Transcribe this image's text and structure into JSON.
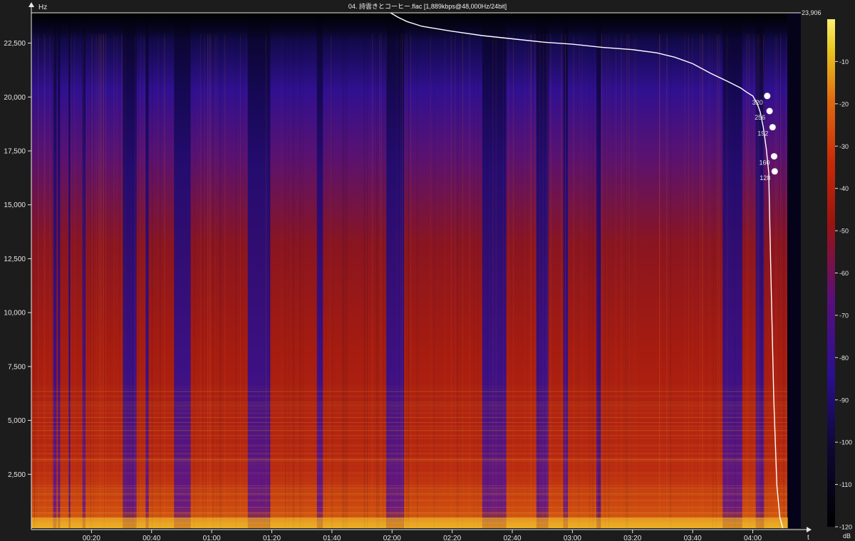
{
  "window": {
    "title": "04. 詩雲きとコーヒー.flac [1,889kbps@48,000Hz/24bit]"
  },
  "chart_data": {
    "type": "heatmap",
    "title": "04. 詩雲きとコーヒー.flac [1,889kbps@48,000Hz/24bit]",
    "xlabel": "t",
    "ylabel": "Hz",
    "colorbar_label": "dB",
    "xlim_seconds": [
      0,
      256
    ],
    "ylim_hz": [
      0,
      23906
    ],
    "x_ticks": [
      {
        "label": "00:20",
        "value": 20
      },
      {
        "label": "00:40",
        "value": 40
      },
      {
        "label": "01:00",
        "value": 60
      },
      {
        "label": "01:20",
        "value": 80
      },
      {
        "label": "01:40",
        "value": 100
      },
      {
        "label": "02:00",
        "value": 120
      },
      {
        "label": "02:20",
        "value": 140
      },
      {
        "label": "02:40",
        "value": 160
      },
      {
        "label": "03:00",
        "value": 180
      },
      {
        "label": "03:20",
        "value": 200
      },
      {
        "label": "03:40",
        "value": 220
      },
      {
        "label": "04:00",
        "value": 240
      }
    ],
    "y_ticks": [
      {
        "label": "2,500",
        "value": 2500
      },
      {
        "label": "5,000",
        "value": 5000
      },
      {
        "label": "7,500",
        "value": 7500
      },
      {
        "label": "10,000",
        "value": 10000
      },
      {
        "label": "12,500",
        "value": 12500
      },
      {
        "label": "15,000",
        "value": 15000
      },
      {
        "label": "17,500",
        "value": 17500
      },
      {
        "label": "20,000",
        "value": 20000
      },
      {
        "label": "22,500",
        "value": 22500
      }
    ],
    "max_freq_label": "23,906",
    "colorbar_ticks": [
      {
        "label": "-10",
        "value": -10
      },
      {
        "label": "-20",
        "value": -20
      },
      {
        "label": "-30",
        "value": -30
      },
      {
        "label": "-40",
        "value": -40
      },
      {
        "label": "-50",
        "value": -50
      },
      {
        "label": "-60",
        "value": -60
      },
      {
        "label": "-70",
        "value": -70
      },
      {
        "label": "-80",
        "value": -80
      },
      {
        "label": "-90",
        "value": -90
      },
      {
        "label": "-100",
        "value": -100
      },
      {
        "label": "-110",
        "value": -110
      },
      {
        "label": "-120",
        "value": -120
      }
    ],
    "colorbar_range_db": [
      -120,
      0
    ],
    "colors": [
      "#000000",
      "#0c0830",
      "#2a0f90",
      "#5a0f78",
      "#9a1410",
      "#c82a08",
      "#e06a10",
      "#e8c820",
      "#fff070"
    ],
    "cutoff_curve": {
      "series": "frequency cutoff",
      "t": [
        119.5,
        122,
        125,
        130,
        140,
        150,
        160,
        170,
        180,
        190,
        200,
        208,
        214,
        220,
        226,
        232,
        236,
        238,
        240,
        241.5,
        242.5,
        243.5,
        244.5,
        245.3,
        246,
        247,
        248,
        249,
        250
      ],
      "hz": [
        23906,
        23700,
        23500,
        23280,
        23050,
        22850,
        22700,
        22550,
        22450,
        22300,
        22200,
        22050,
        21850,
        21550,
        21100,
        20700,
        20420,
        20220,
        20050,
        19700,
        19300,
        18600,
        17600,
        16500,
        12000,
        6000,
        2000,
        500,
        0
      ]
    },
    "bitrate_markers": [
      {
        "label": "320",
        "t": 244.8,
        "hz": 20050
      },
      {
        "label": "256",
        "t": 245.6,
        "hz": 19350
      },
      {
        "label": "192",
        "t": 246.6,
        "hz": 18600
      },
      {
        "label": "160",
        "t": 247.1,
        "hz": 17250
      },
      {
        "label": "128",
        "t": 247.3,
        "hz": 16550
      }
    ],
    "grid": false
  }
}
